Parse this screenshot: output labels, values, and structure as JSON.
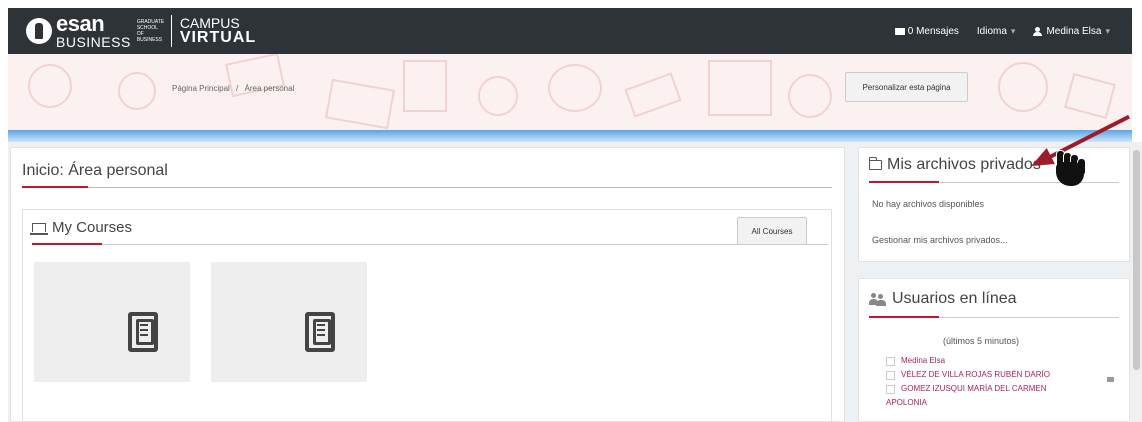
{
  "navbar": {
    "logo": {
      "brand": "esan",
      "sub": "BUSINESS",
      "small": "GRADUATE SCHOOL OF BUSINESS",
      "campus_line1": "CAMPUS",
      "campus_line2": "VIRTUAL"
    },
    "messages_label": "0 Mensajes",
    "language_label": "Idioma",
    "user_label": "Medina Elsa",
    "bg_color": "#2e3338"
  },
  "breadcrumb": {
    "home": "Página Principal",
    "separator": "/",
    "current": "Área personal"
  },
  "customize_button": "Personalizar esta página",
  "main": {
    "page_heading": "Inicio: Área personal",
    "courses": {
      "title": "My Courses",
      "all_courses_button": "All Courses",
      "tiles": [
        {
          "icon": "book-icon"
        },
        {
          "icon": "book-icon"
        }
      ]
    }
  },
  "blocks": {
    "private_files": {
      "title": "Mis archivos privados",
      "empty_text": "No hay archivos disponibles",
      "manage_link": "Gestionar mis archivos privados..."
    },
    "online_users": {
      "title": "Usuarios en línea",
      "subtitle": "(últimos 5 minutos)",
      "users": [
        "Medina Elsa",
        "VÉLEZ DE VILLA ROJAS RUBÉN DARÍO",
        "GOMEZ IZUSQUI MARÍA DEL CARMEN",
        "APOLONIA"
      ]
    }
  },
  "colors": {
    "accent": "#c0172f",
    "link": "#b0215e",
    "header_band": "#fbf1f1"
  }
}
